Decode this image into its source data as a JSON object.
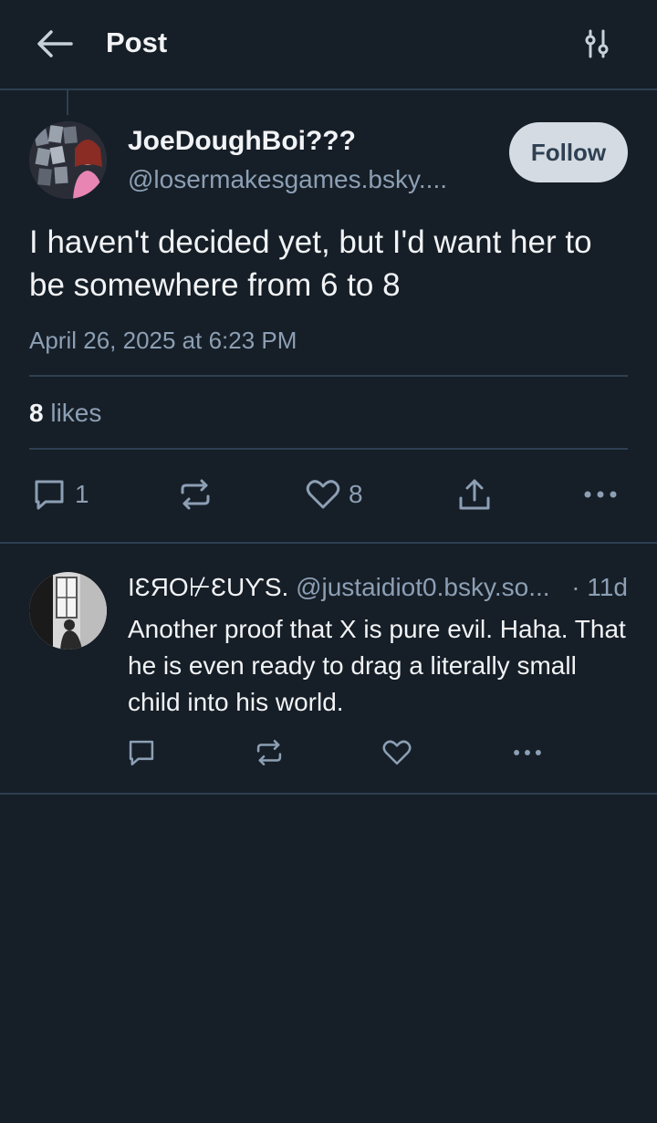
{
  "header": {
    "title": "Post",
    "back_icon": "arrow-left-icon",
    "settings_icon": "sliders-icon"
  },
  "post": {
    "author_name": "JoeDoughBoi???",
    "author_handle": "@losermakesgames.bsky....",
    "follow_label": "Follow",
    "text": "I haven't decided yet, but I'd want her to be somewhere from 6 to 8",
    "date": "April 26, 2025 at 6:23 PM",
    "likes_count": "8",
    "likes_label": "likes",
    "actions": {
      "reply_count": "1",
      "like_count": "8"
    }
  },
  "reply": {
    "author_name": "IƐЯO⊬ƐUƳS.",
    "author_handle": "@justaidiot0.bsky.so...",
    "time": "· 11d",
    "text": "Another proof that X is pure evil. Haha. That he is even ready to drag a literally small child into his world."
  },
  "colors": {
    "background": "#161e27",
    "divider": "#2e4052",
    "muted_text": "#8c9fb4",
    "primary_text": "#f1f3f5",
    "follow_bg": "#d4dbe2"
  }
}
